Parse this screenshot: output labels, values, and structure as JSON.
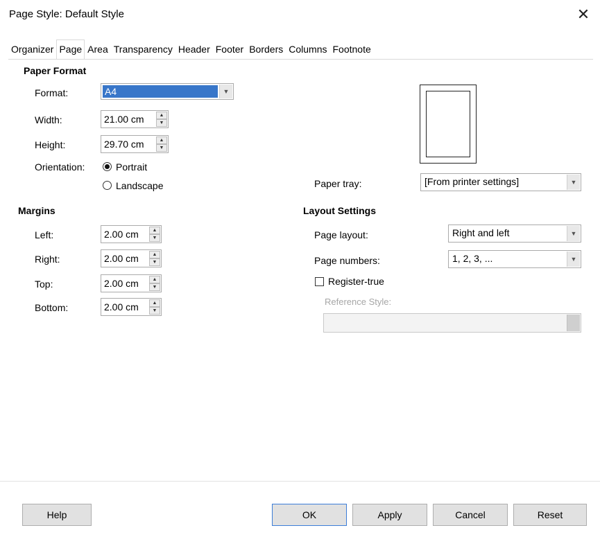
{
  "window": {
    "title": "Page Style: Default Style",
    "close_symbol": "✕"
  },
  "tabs": [
    "Organizer",
    "Page",
    "Area",
    "Transparency",
    "Header",
    "Footer",
    "Borders",
    "Columns",
    "Footnote"
  ],
  "active_tab": "Page",
  "paper_format": {
    "heading": "Paper Format",
    "format_label": "Format:",
    "format_value": "A4",
    "width_label": "Width:",
    "width_value": "21.00 cm",
    "height_label": "Height:",
    "height_value": "29.70 cm",
    "orientation_label": "Orientation:",
    "portrait_label": "Portrait",
    "landscape_label": "Landscape",
    "orientation_selected": "Portrait"
  },
  "paper_tray": {
    "label": "Paper tray:",
    "value": "[From printer settings]"
  },
  "margins": {
    "heading": "Margins",
    "left_label": "Left:",
    "left_value": "2.00 cm",
    "right_label": "Right:",
    "right_value": "2.00 cm",
    "top_label": "Top:",
    "top_value": "2.00 cm",
    "bottom_label": "Bottom:",
    "bottom_value": "2.00 cm"
  },
  "layout": {
    "heading": "Layout Settings",
    "page_layout_label": "Page layout:",
    "page_layout_value": "Right and left",
    "page_numbers_label": "Page numbers:",
    "page_numbers_value": "1, 2, 3, ...",
    "register_true_label": "Register-true",
    "register_true_checked": false,
    "reference_style_label": "Reference Style:",
    "reference_style_value": ""
  },
  "buttons": {
    "help": "Help",
    "ok": "OK",
    "apply": "Apply",
    "cancel": "Cancel",
    "reset": "Reset"
  },
  "colors": {
    "selection": "#3876c9",
    "default_button_border": "#3b7dd8"
  }
}
